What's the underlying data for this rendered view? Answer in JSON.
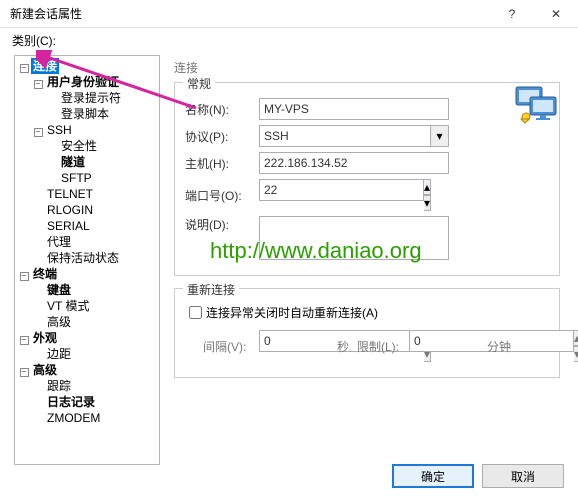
{
  "window": {
    "title": "新建会话属性",
    "help_glyph": "?",
    "close_glyph": "✕"
  },
  "category_label": "类别(C):",
  "tree": {
    "n_conn": "连接",
    "n_auth": "用户身份验证",
    "n_prompt": "登录提示符",
    "n_script": "登录脚本",
    "n_ssh": "SSH",
    "n_sec": "安全性",
    "n_tunnel": "隧道",
    "n_sftp": "SFTP",
    "n_telnet": "TELNET",
    "n_rlogin": "RLOGIN",
    "n_serial": "SERIAL",
    "n_proxy": "代理",
    "n_keep": "保持活动状态",
    "n_term": "终端",
    "n_keyb": "键盘",
    "n_vt": "VT 模式",
    "n_adv1": "高级",
    "n_look": "外观",
    "n_margin": "边距",
    "n_adv2": "高级",
    "n_trace": "跟踪",
    "n_log": "日志记录",
    "n_zmodem": "ZMODEM"
  },
  "panel": {
    "title": "连接",
    "group_general": "常规",
    "name_label": "名称(N):",
    "name_value": "MY-VPS",
    "protocol_label": "协议(P):",
    "protocol_value": "SSH",
    "host_label": "主机(H):",
    "host_value": "222.186.134.52",
    "port_label": "端口号(O):",
    "port_value": "22",
    "desc_label": "说明(D):",
    "desc_value": "",
    "group_reconn": "重新连接",
    "reconn_chk": "连接异常关闭时自动重新连接(A)",
    "interval_label": "间隔(V):",
    "interval_value": "0",
    "seconds": "秒",
    "limit_label": "限制(L):",
    "limit_value": "0",
    "minutes": "分钟"
  },
  "buttons": {
    "ok": "确定",
    "cancel": "取消"
  },
  "overlay": {
    "watermark": "http://www.daniao.org"
  },
  "glyph": {
    "down": "▾",
    "up": "▴",
    "minus": "−",
    "plus": "+"
  }
}
